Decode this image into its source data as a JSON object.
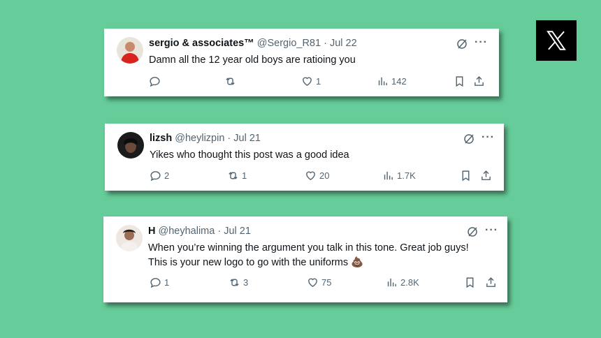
{
  "brand": {
    "icon": "x-logo-icon"
  },
  "tweets": [
    {
      "name": "sergio & associates™",
      "handle": "@Sergio_R81",
      "date": "Jul 22",
      "text": [
        "Damn all the 12 year old boys are ratioing you"
      ],
      "replies": "",
      "reposts": "",
      "likes": "1",
      "views": "142",
      "avatar_color": "#d9231f"
    },
    {
      "name": "lizsh",
      "handle": "@heylizpin",
      "date": "Jul 21",
      "text": [
        "Yikes who thought this post was a good idea"
      ],
      "replies": "2",
      "reposts": "1",
      "likes": "20",
      "views": "1.7K",
      "avatar_color": "#1b1b1b"
    },
    {
      "name": "H",
      "handle": "@heyhalima",
      "date": "Jul 21",
      "text": [
        "When you’re winning the argument you talk in this tone. Great job guys!",
        "This is your new logo to go with the uniforms"
      ],
      "emoji": "💩",
      "replies": "1",
      "reposts": "3",
      "likes": "75",
      "views": "2.8K",
      "avatar_color": "#b9a99e"
    }
  ],
  "header_sep": " · "
}
